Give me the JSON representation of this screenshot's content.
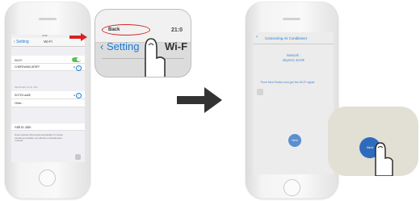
{
  "left_phone": {
    "status_time": "21:06",
    "nav": {
      "back_label": "Setting",
      "title": "Wi-Fi"
    },
    "wifi_toggle_label": "Wi-Fi",
    "connected_network": "CH8PDWMG-8F8FF",
    "section_header": "NETWORK IN  No. 501",
    "networks": [
      "DGTEG-aa5E",
      "Other..."
    ],
    "ask_to_join": "Ask to Join",
    "footer_note": "Known networks will be joined automatically. If no known networks are available, you will have to manually select a network."
  },
  "zoom_left": {
    "back_small": "Back",
    "time": "21:0",
    "back_label": "Setting",
    "title": "Wi-F"
  },
  "right_phone": {
    "nav": {
      "back_icon": "chevron-left-icon",
      "title": "Connecting Air Conditioner"
    },
    "network_label": "Network :",
    "network_name": "SkySAC-EA0F",
    "instruction": "Push Next Button and get the Wi-Fi signal",
    "next_label": "Next"
  },
  "zoom_right": {
    "next_label": "Next"
  },
  "colors": {
    "ios_blue": "#1a7bd9",
    "highlight_red": "#d22a2a",
    "arrow_red": "#d9221f",
    "next_blue": "#2f6bbd"
  }
}
